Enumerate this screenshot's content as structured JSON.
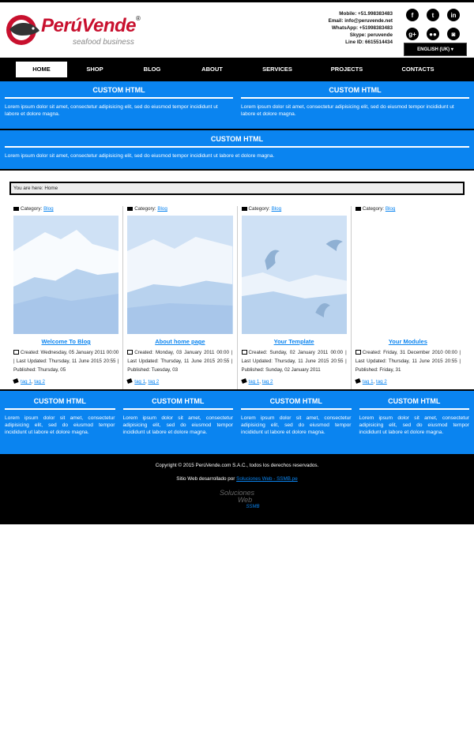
{
  "brand": {
    "name": "PerúVende",
    "registered": "®",
    "tagline": "seafood business"
  },
  "contact": {
    "mobile": "Mobile: +51.998383483",
    "email": "Email: info@peruvende.net",
    "whatsapp": "WhatsApp: +51998383483",
    "skype": "Skype: peruvende",
    "line": "Line ID: 6615514434"
  },
  "socials": [
    {
      "icon": "facebook-icon",
      "glyph": "f"
    },
    {
      "icon": "twitter-icon",
      "glyph": "t"
    },
    {
      "icon": "linkedin-icon",
      "glyph": "in"
    },
    {
      "icon": "google-plus-icon",
      "glyph": "g+"
    },
    {
      "icon": "flickr-icon",
      "glyph": "●●"
    },
    {
      "icon": "instagram-icon",
      "glyph": "◙"
    }
  ],
  "language": {
    "selected": "ENGLISH (UK)",
    "caret": "▾"
  },
  "nav": {
    "items": [
      "HOME",
      "SHOP",
      "BLOG",
      "ABOUT",
      "SERVICES",
      "PROJECTS",
      "CONTACTS"
    ]
  },
  "modules_top": [
    {
      "title": "CUSTOM HTML",
      "text": "Lorem ipsum dolor sit amet, consectetur adipisicing elit, sed do eiusmod tempor incididunt ut labore et dolore magna."
    },
    {
      "title": "CUSTOM HTML",
      "text": "Lorem ipsum dolor sit amet, consectetur adipisicing elit, sed do eiusmod tempor incididunt ut labore et dolore magna."
    }
  ],
  "module_wide": {
    "title": "CUSTOM HTML",
    "text": "Lorem ipsum dolor sit amet, consectetur adipisicing elit, sed do eiusmod tempor incididunt ut labore et dolore magna."
  },
  "breadcrumb": "You are here:  Home",
  "articles": [
    {
      "category_label": "Category:",
      "category": "Blog",
      "title": "Welcome To Blog",
      "meta": "Created: Wednesday, 05 January 2011 00:00 | Last Updated: Thursday, 11 June 2015 20:55 | Published: Thursday, 05",
      "tags": [
        "tag 1",
        "tag 2"
      ]
    },
    {
      "category_label": "Category:",
      "category": "Blog",
      "title": "About home page",
      "meta": "Created: Monday, 03 January 2011 00:00 | Last Updated: Thursday, 11 June 2015 20:55 | Published: Tuesday, 03",
      "tags": [
        "tag 1",
        "tag 2"
      ]
    },
    {
      "category_label": "Category:",
      "category": "Blog",
      "title": "Your Template",
      "meta": "Created: Sunday, 02 January 2011 00:00 | Last Updated: Thursday, 11 June 2015 20:55 | Published: Sunday, 02 January 2011",
      "tags": [
        "tag 1",
        "tag 2"
      ]
    },
    {
      "category_label": "Category:",
      "category": "Blog",
      "title": "Your Modules",
      "meta": "Created: Friday, 31 December 2010 00:00 | Last Updated: Thursday, 11 June 2015 20:55 | Published: Friday, 31",
      "tags": [
        "tag 1",
        "tag 2"
      ]
    }
  ],
  "modules_bottom": [
    {
      "title": "CUSTOM HTML",
      "text": "Lorem ipsum dolor sit amet, consectetur adipisicing elit, sed do eiusmod tempor incididunt ut labore et dolore magna."
    },
    {
      "title": "CUSTOM HTML",
      "text": "Lorem ipsum dolor sit amet, consectetur adipisicing elit, sed do eiusmod tempor incididunt ut labore et dolore magna."
    },
    {
      "title": "CUSTOM HTML",
      "text": "Lorem ipsum dolor sit amet, consectetur adipisicing elit, sed do eiusmod tempor incididunt ut labore et dolore magna."
    },
    {
      "title": "CUSTOM HTML",
      "text": "Lorem ipsum dolor sit amet, consectetur adipisicing elit, sed do eiusmod tempor incididunt ut labore et dolore magna."
    }
  ],
  "footer": {
    "copyright": "Copyright © 2015 PerúVende.com S.A.C., todos los derechos reservados.",
    "dev_prefix": "Sitio Web desarrollado por",
    "dev_link": "Soluciones Web - SSMB.pe",
    "logo_line1": "Soluciones",
    "logo_line2": "Web",
    "logo_line3": "SSMB"
  },
  "colors": {
    "accent": "#0a84f0",
    "brand_red": "#c8102e",
    "dark": "#000000"
  }
}
